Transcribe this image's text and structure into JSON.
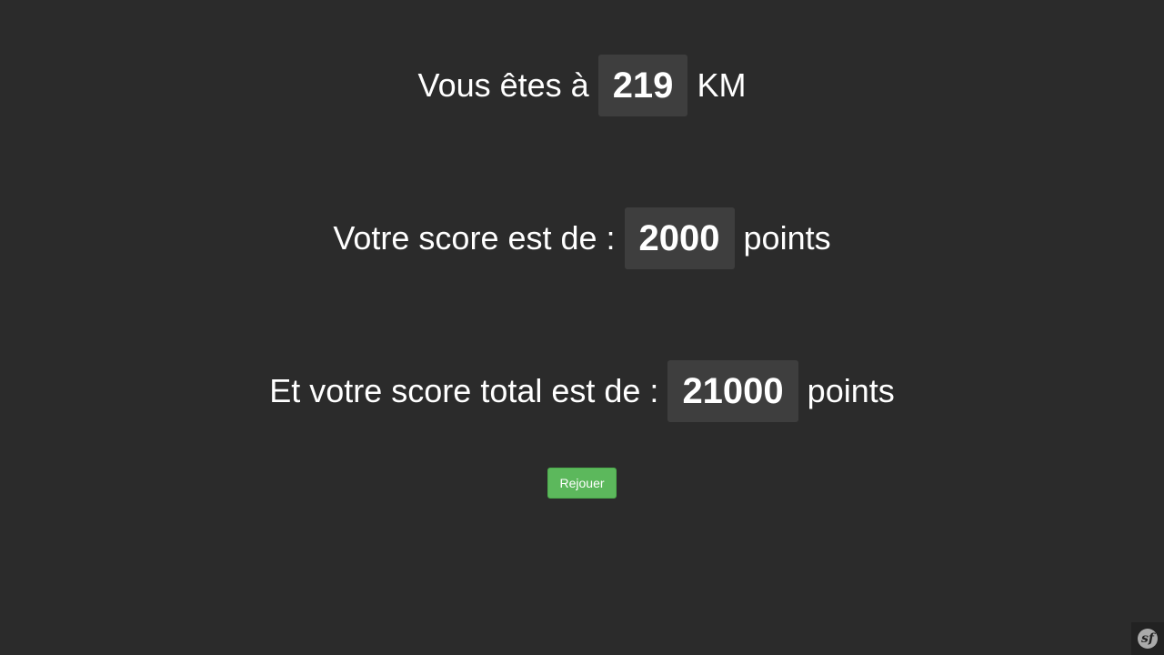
{
  "result": {
    "distance": {
      "prefix": "Vous êtes à",
      "value": "219",
      "suffix": "KM"
    },
    "score": {
      "prefix": "Votre score est de :",
      "value": "2000",
      "suffix": "points"
    },
    "total": {
      "prefix": "Et votre score total est de :",
      "value": "21000",
      "suffix": "points"
    }
  },
  "actions": {
    "replay_label": "Rejouer"
  },
  "toolbar": {
    "logo_glyph": "sf",
    "logo_icon": "symfony-icon"
  },
  "colors": {
    "background": "#2b2b2b",
    "value_box": "#3e3e3e",
    "replay_button": "#5cb85c"
  }
}
